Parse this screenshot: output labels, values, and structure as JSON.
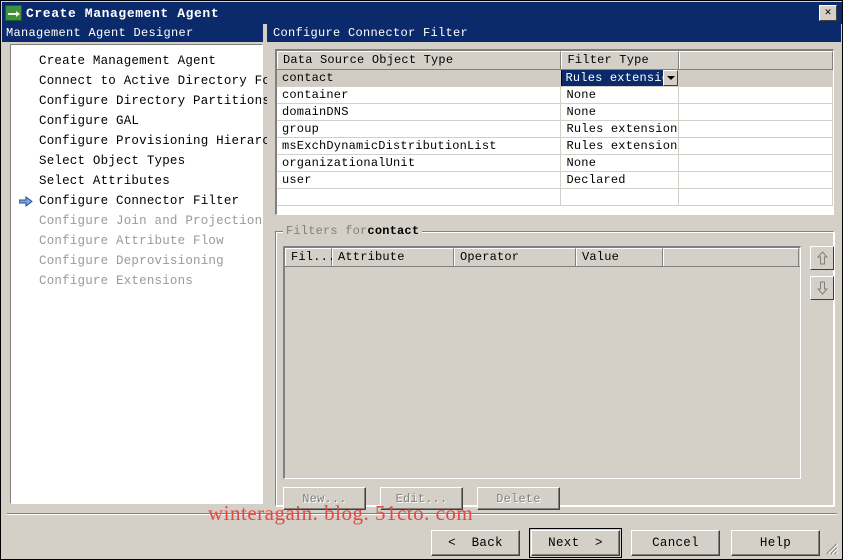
{
  "window": {
    "title": "Create Management Agent",
    "icon": "agent-icon",
    "close_label": "✕"
  },
  "left_pane": {
    "header": "Management Agent Designer",
    "items": [
      {
        "label": "Create Management Agent",
        "state": "done"
      },
      {
        "label": "Connect to Active Directory Forest",
        "state": "done"
      },
      {
        "label": "Configure Directory Partitions",
        "state": "done"
      },
      {
        "label": "Configure GAL",
        "state": "done"
      },
      {
        "label": "Configure Provisioning Hierarchy",
        "state": "done"
      },
      {
        "label": "Select Object Types",
        "state": "done"
      },
      {
        "label": "Select Attributes",
        "state": "done"
      },
      {
        "label": "Configure Connector Filter",
        "state": "current"
      },
      {
        "label": "Configure Join and Projection Rules",
        "state": "disabled"
      },
      {
        "label": "Configure Attribute Flow",
        "state": "disabled"
      },
      {
        "label": "Configure Deprovisioning",
        "state": "disabled"
      },
      {
        "label": "Configure Extensions",
        "state": "disabled"
      }
    ]
  },
  "right_pane": {
    "header": "Configure Connector Filter",
    "object_grid": {
      "columns": [
        "Data Source Object Type",
        "Filter Type",
        ""
      ],
      "rows": [
        {
          "object_type": "contact",
          "filter_type": "Rules extension",
          "selected": true
        },
        {
          "object_type": "container",
          "filter_type": "None",
          "selected": false
        },
        {
          "object_type": "domainDNS",
          "filter_type": "None",
          "selected": false
        },
        {
          "object_type": "group",
          "filter_type": "Rules extension",
          "selected": false
        },
        {
          "object_type": "msExchDynamicDistributionList",
          "filter_type": "Rules extension",
          "selected": false
        },
        {
          "object_type": "organizationalUnit",
          "filter_type": "None",
          "selected": false
        },
        {
          "object_type": "user",
          "filter_type": "Declared",
          "selected": false
        }
      ],
      "combo": {
        "value": "Rules extension",
        "arrow": "chevron-down-icon"
      }
    },
    "filters_group": {
      "label_prefix": "Filters for",
      "label_target": "contact",
      "columns": [
        "Fil...",
        "Attribute",
        "Operator",
        "Value",
        ""
      ],
      "rows": [],
      "move_up": "arrow-up-icon",
      "move_down": "arrow-down-icon",
      "buttons": [
        {
          "label": "New...",
          "mnemonic": "w",
          "enabled": false
        },
        {
          "label": "Edit...",
          "mnemonic": "E",
          "enabled": false
        },
        {
          "label": "Delete",
          "mnemonic": "D",
          "enabled": false
        }
      ]
    }
  },
  "footer": {
    "back": "Back",
    "back_prefix": "<",
    "next": "Next",
    "next_suffix": ">",
    "cancel": "Cancel",
    "help": "Help"
  },
  "watermark": "winteragain. blog. 51cto. com",
  "colors": {
    "titlebar": "#0b2a6b",
    "face": "#d4d0c8",
    "selection": "#0b2a6b",
    "watermark": "#e04a43"
  }
}
